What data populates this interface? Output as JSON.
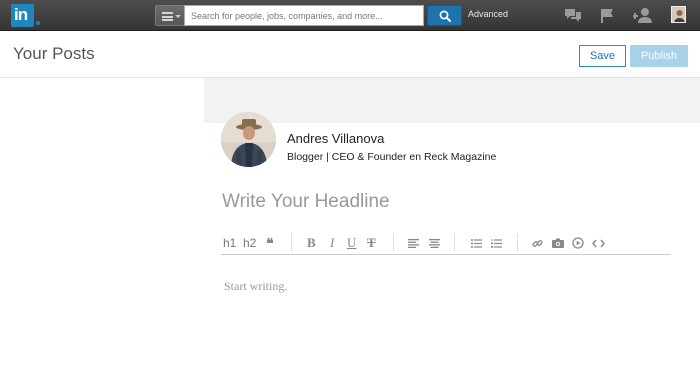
{
  "nav": {
    "logo_text": "in",
    "search_placeholder": "Search for people, jobs, companies, and more...",
    "advanced_label": "Advanced",
    "icons": [
      "messages-icon",
      "flag-icon",
      "add-connection-icon",
      "profile-avatar"
    ]
  },
  "header": {
    "title": "Your Posts",
    "save_label": "Save",
    "publish_label": "Publish"
  },
  "author": {
    "name": "Andres Villanova",
    "title": "Blogger | CEO & Founder en Reck Magazine"
  },
  "editor": {
    "headline_placeholder": "Write Your Headline",
    "body_placeholder": "Start writing.",
    "toolbar": {
      "h1": "h1",
      "h2": "h2",
      "quote": "❝",
      "bold": "B",
      "italic": "I",
      "underline": "U",
      "strike": "T"
    }
  },
  "colors": {
    "brand_blue": "#1d87be",
    "nav_bg": "#3f3f3f",
    "publish_disabled": "#a8d1ea",
    "save_border": "#2d8cc4"
  }
}
